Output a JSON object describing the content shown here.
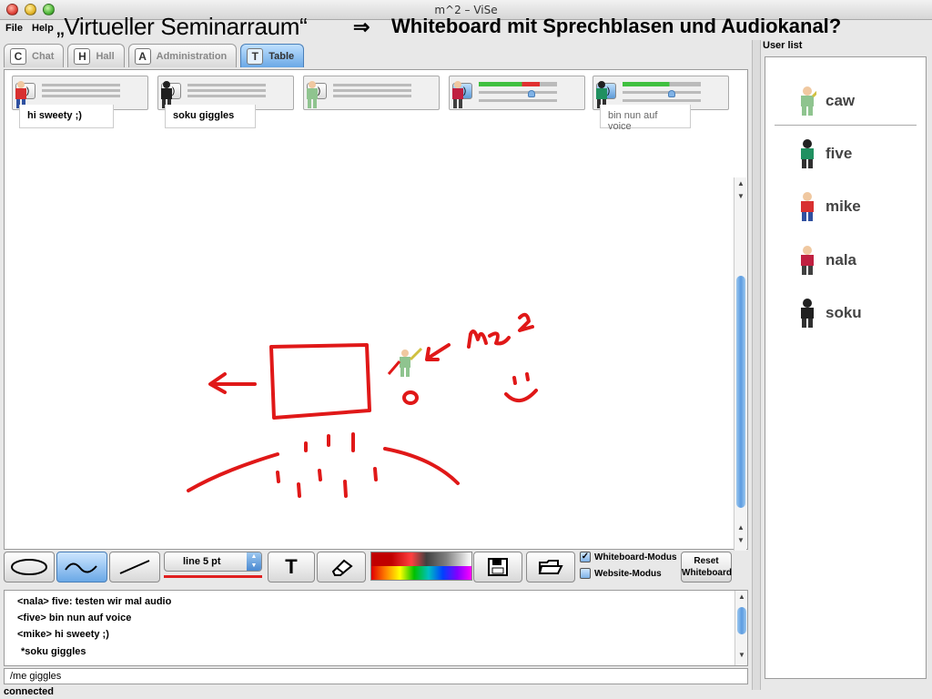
{
  "window": {
    "title": "m^2 – ViSe"
  },
  "menu": {
    "file": "File",
    "help": "Help"
  },
  "headline": {
    "left": "„Virtueller Seminarraum“",
    "arrow": "⇒",
    "right": "Whiteboard mit Sprechblasen und Audiokanal?"
  },
  "tabs": [
    {
      "letter": "C",
      "label": "Chat"
    },
    {
      "letter": "H",
      "label": "Hall"
    },
    {
      "letter": "A",
      "label": "Administration"
    },
    {
      "letter": "T",
      "label": "Table"
    }
  ],
  "active_tab": "Table",
  "voice_panels": [
    {
      "speaker_on": false,
      "avatar_color": "#d83030",
      "bubble": "hi sweety ;)"
    },
    {
      "speaker_on": false,
      "avatar_color": "#202020",
      "bubble": "soku giggles"
    },
    {
      "speaker_on": false,
      "avatar_color": "#8fc48f",
      "bubble": ""
    },
    {
      "speaker_on": true,
      "avatar_color": "#c02040",
      "bubble": ""
    },
    {
      "speaker_on": true,
      "avatar_color": "#209060",
      "bubble": "bin nun auf voice"
    }
  ],
  "whiteboard": {
    "annotation": "me²"
  },
  "toolbar": {
    "line_label": "line  5 pt",
    "text_tool": "T",
    "whiteboard_mode": "Whiteboard-Modus",
    "website_mode": "Website-Modus",
    "reset_line1": "Reset",
    "reset_line2": "Whiteboard"
  },
  "chat": {
    "lines": [
      "<nala> five: testen wir mal audio",
      "<five> bin nun auf voice",
      "<mike> hi sweety ;)",
      "*soku giggles"
    ]
  },
  "input": {
    "value": "/me giggles"
  },
  "status": "connected",
  "userlist": {
    "title": "User list",
    "users": [
      {
        "name": "caw",
        "color": "#8fc48f"
      },
      {
        "name": "five",
        "color": "#209060"
      },
      {
        "name": "mike",
        "color": "#d83030"
      },
      {
        "name": "nala",
        "color": "#c02040"
      },
      {
        "name": "soku",
        "color": "#202020"
      }
    ]
  },
  "colors": {
    "accent": "#5b9be0",
    "ink": "#e01818"
  }
}
